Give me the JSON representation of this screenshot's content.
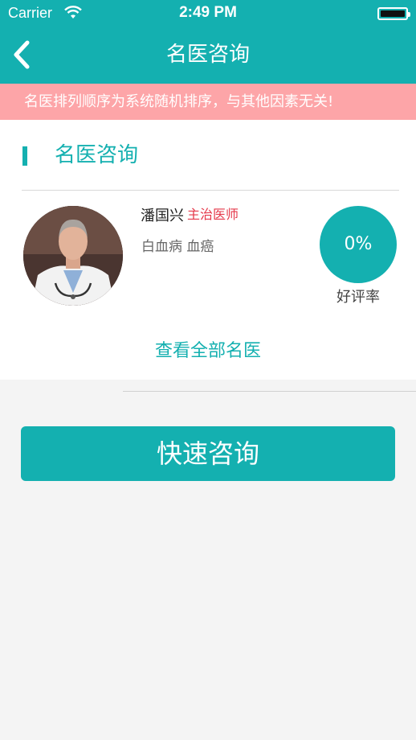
{
  "status_bar": {
    "carrier": "Carrier",
    "time": "2:49 PM"
  },
  "nav": {
    "title": "名医咨询",
    "back_icon": "chevron-left-icon"
  },
  "notice": {
    "text": "名医排列顺序为系统随机排序，与其他因素无关!"
  },
  "section": {
    "title": "名医咨询"
  },
  "doctor": {
    "name": "潘国兴",
    "title": "主治医师",
    "specialties": "白血病 血癌",
    "rating": "0%",
    "rating_label": "好评率"
  },
  "view_all_label": "查看全部名医",
  "quick_consult_label": "快速咨询",
  "colors": {
    "accent": "#14b0b0",
    "notice_bg": "#fda5a8",
    "doctor_title": "#e5384a",
    "page_bg": "#f4f4f4"
  }
}
